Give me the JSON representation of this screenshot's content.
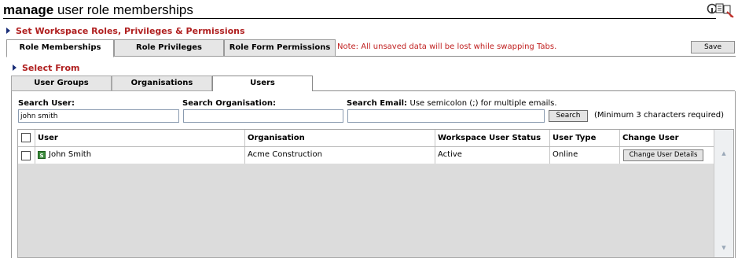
{
  "header": {
    "title_bold": "manage",
    "title_rest": " user role memberships",
    "icon": "help-print-tools-icon"
  },
  "section_title": "Set Workspace Roles, Privileges & Permissions",
  "main_tabs": [
    {
      "label": "Role Memberships",
      "active": true
    },
    {
      "label": "Role Privileges",
      "active": false
    },
    {
      "label": "Role Form Permissions",
      "active": false
    }
  ],
  "tab_note": "Note: All unsaved data will be lost while swapping Tabs.",
  "save_label": "Save",
  "select_from_title": "Select From",
  "sub_tabs": [
    {
      "label": "User Groups",
      "active": false
    },
    {
      "label": "Organisations",
      "active": false
    },
    {
      "label": "Users",
      "active": true
    }
  ],
  "search": {
    "user_label": "Search User:",
    "user_value": "john smith",
    "org_label": "Search Organisation:",
    "org_value": "",
    "email_label": "Search Email:",
    "email_hint": "Use semicolon (;) for multiple emails.",
    "email_value": "",
    "button_label": "Search",
    "min_note": "(Minimum 3 characters required)"
  },
  "grid": {
    "columns": [
      "User",
      "Organisation",
      "Workspace User Status",
      "User Type",
      "Change User"
    ],
    "rows": [
      {
        "user_icon": "S",
        "user": "John Smith",
        "organisation": "Acme Construction",
        "status": "Active",
        "user_type": "Online",
        "action_label": "Change User Details"
      }
    ]
  },
  "colors": {
    "accent_red": "#b02020",
    "note_red": "#c02020",
    "bullet_blue": "#1a2e78",
    "grid_bg": "#dcdcdc"
  }
}
